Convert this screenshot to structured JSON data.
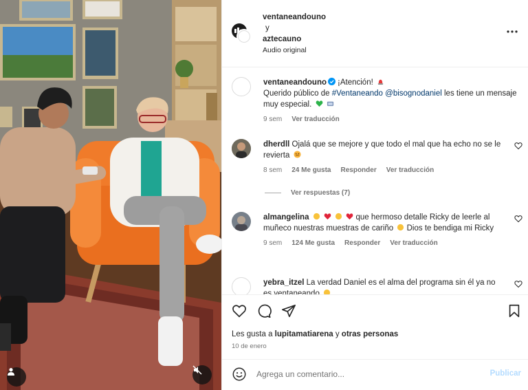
{
  "post": {
    "author_primary": "ventaneandouno",
    "and_word": "y",
    "author_secondary": "aztecauno",
    "audio_label": "Audio original"
  },
  "caption": {
    "username": "ventaneandouno",
    "text_start": "¡Atención!",
    "line2_prefix": "Querido público de ",
    "hashtag": "#Ventaneando",
    "mention": "@bisognodaniel",
    "line2_suffix": " les tiene un mensaje muy especial.",
    "time": "9 sem",
    "translate": "Ver traducción"
  },
  "comments": [
    {
      "username": "dherdll",
      "text": "Ojalá que se mejore y que todo el mal que ha echo no se le revierta",
      "time": "8 sem",
      "likes": "24 Me gusta",
      "reply": "Responder",
      "translate": "Ver traducción",
      "replies_label": "Ver respuestas (7)"
    },
    {
      "username": "almangelina",
      "text": "que hermoso detalle Ricky de leerle al muñeco nuestras muestras de cariño",
      "text_end": "Dios te bendiga mi Ricky",
      "time": "9 sem",
      "likes": "124 Me gusta",
      "reply": "Responder",
      "translate": "Ver traducción"
    },
    {
      "username": "yebra_itzel",
      "text": "La verdad Daniel es el alma del programa sin él ya no es ventaneando"
    }
  ],
  "likes_summary": {
    "prefix": "Les gusta a ",
    "user": "lupitamatiarena",
    "middle": " y ",
    "others": "otras personas"
  },
  "date": "10 de enero",
  "composer": {
    "placeholder": "Agrega un comentario...",
    "publish": "Publicar"
  },
  "icons": [
    "more-options-icon",
    "verified-icon",
    "heart-icon",
    "comment-icon",
    "share-icon",
    "save-icon",
    "emoji-icon",
    "user-tag-icon",
    "mute-icon"
  ],
  "colors": {
    "link": "#00376b",
    "meta": "#737373",
    "publish_disabled": "#b3dbff",
    "verified": "#0095f6"
  }
}
